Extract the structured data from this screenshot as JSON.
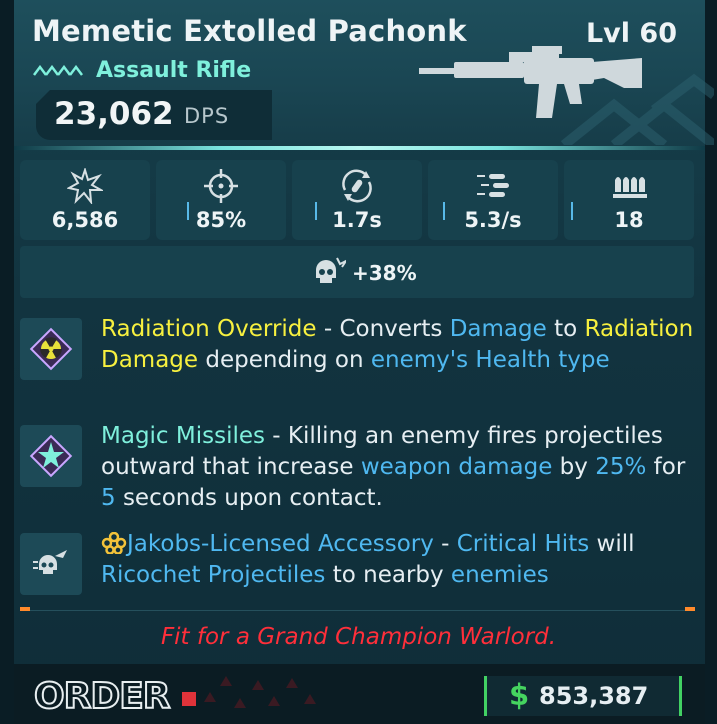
{
  "item": {
    "name": "Memetic Extolled Pachonk",
    "level": "Lvl 60",
    "type": "Assault Rifle",
    "dps_value": "23,062",
    "dps_unit": "DPS"
  },
  "stats": [
    {
      "icon": "damage-burst-icon",
      "value": "6,586"
    },
    {
      "icon": "crosshair-icon",
      "value": "85%"
    },
    {
      "icon": "reload-icon",
      "value": "1.7s"
    },
    {
      "icon": "fire-rate-icon",
      "value": "5.3/s"
    },
    {
      "icon": "magazine-icon",
      "value": "18"
    }
  ],
  "bonus": {
    "icon": "crit-skull-icon",
    "value": "+38%"
  },
  "perks": {
    "radiation": {
      "name": "Radiation Override",
      "t1": " - Converts ",
      "k1": "Damage",
      "t2": " to ",
      "k2": "Radiation Damage",
      "t3": " depending on ",
      "k3": "enemy's Health type"
    },
    "missiles": {
      "name": "Magic Missiles",
      "t1": " - Killing an enemy fires projectiles outward that increase ",
      "k1": "weapon damage",
      "t2": " by ",
      "k2": "25%",
      "t3": " for ",
      "k3": "5",
      "t4": " seconds upon contact."
    },
    "jakobs": {
      "name": "Jakobs-Licensed Accessory",
      "t1": " - ",
      "k1": "Critical Hits",
      "t2": " will ",
      "k2": "Ricochet Projectiles",
      "t3": " to nearby ",
      "k3": "enemies"
    }
  },
  "flavor_text": "Fit for a Grand Champion Warlord.",
  "manufacturer_logo": "ORDER",
  "price": {
    "symbol": "$",
    "value": "853,387"
  },
  "colors": {
    "accent_cyan": "#7ff0dc",
    "keyword_blue": "#4fb8f0",
    "keyword_yellow": "#f7f03f",
    "flavor_red": "#ff2f3a",
    "price_green": "#45d45f"
  }
}
